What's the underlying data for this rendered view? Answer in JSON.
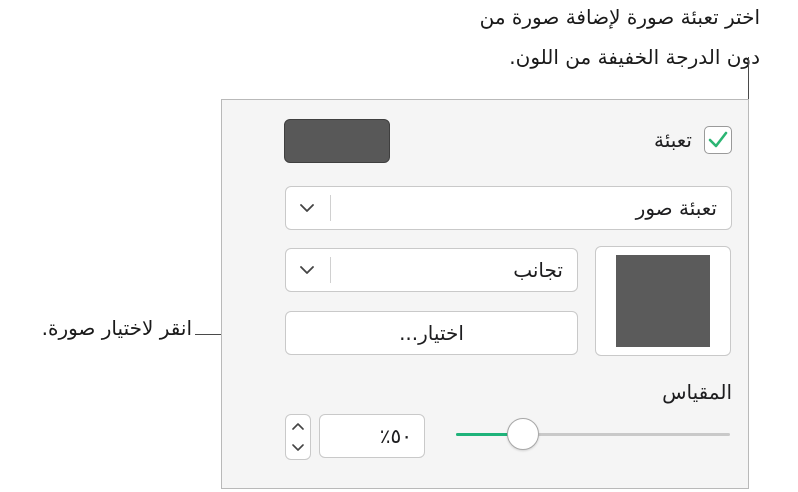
{
  "callouts": {
    "top_line1": "اختر تعبئة صورة لإضافة صورة من",
    "top_line2": "دون الدرجة الخفيفة من اللون.",
    "left": "انقر لاختيار صورة."
  },
  "fill": {
    "label": "تعبئة",
    "checked": true,
    "swatch_color": "#585858"
  },
  "fill_type": {
    "value": "تعبئة صور"
  },
  "tile_mode": {
    "value": "تجانب"
  },
  "choose_button": {
    "label": "اختيار..."
  },
  "image_color": "#5b5b5b",
  "scale": {
    "label": "المقياس",
    "value_text": "٪٥٠",
    "value": 50,
    "slider_fraction": 0.22
  },
  "colors": {
    "accent": "#1fb37a",
    "check": "#2bb573"
  },
  "icons": [
    "checkmark-icon",
    "chevron-down-icon",
    "chevron-up-icon"
  ]
}
